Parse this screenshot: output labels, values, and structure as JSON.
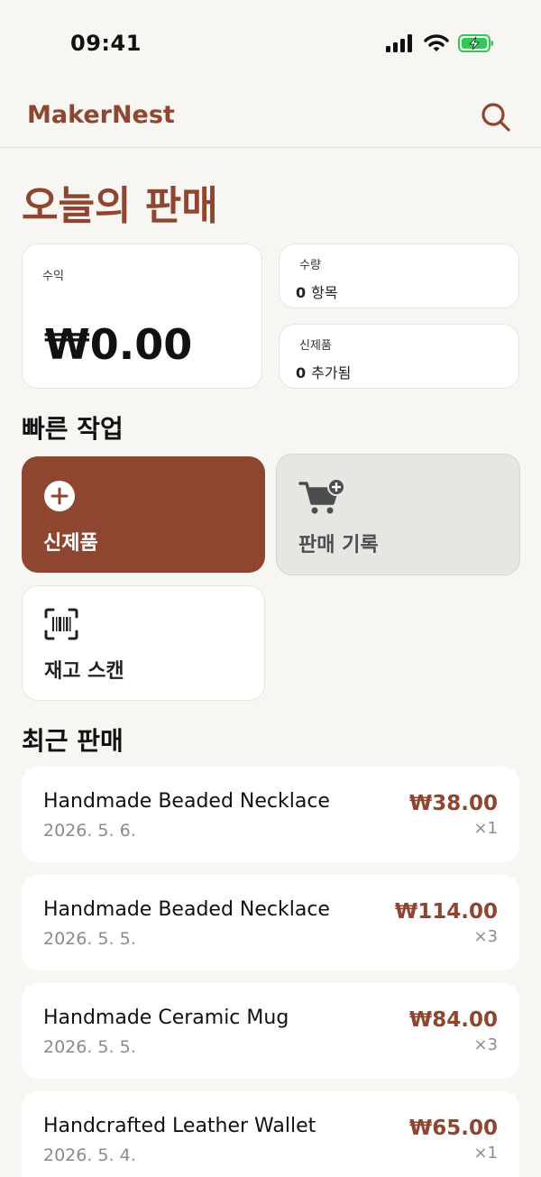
{
  "status": {
    "time": "09:41"
  },
  "header": {
    "brand": "MakerNest"
  },
  "page": {
    "title": "오늘의 판매"
  },
  "stats": {
    "revenue": {
      "label": "수익",
      "value": "₩0.00"
    },
    "quantity": {
      "label": "수량",
      "count": "0",
      "unit": "항목"
    },
    "new_products": {
      "label": "신제품",
      "count": "0",
      "unit": "추가됨"
    }
  },
  "quick_actions": {
    "title": "빠른 작업",
    "new_product": "신제품",
    "record_sale": "판매 기록",
    "scan_inventory": "재고 스캔"
  },
  "recent_sales": {
    "title": "최근 판매",
    "items": [
      {
        "name": "Handmade Beaded Necklace",
        "date": "2026. 5. 6.",
        "price": "₩38.00",
        "qty": "×1"
      },
      {
        "name": "Handmade Beaded Necklace",
        "date": "2026. 5. 5.",
        "price": "₩114.00",
        "qty": "×3"
      },
      {
        "name": "Handmade Ceramic Mug",
        "date": "2026. 5. 5.",
        "price": "₩84.00",
        "qty": "×3"
      },
      {
        "name": "Handcrafted Leather Wallet",
        "date": "2026. 5. 4.",
        "price": "₩65.00",
        "qty": "×1"
      }
    ]
  },
  "colors": {
    "accent": "#8f4630",
    "background": "#f8f6f2",
    "battery": "#34c759"
  },
  "icons": {
    "search": "search-icon",
    "add": "plus-circle-icon",
    "cart": "cart-plus-icon",
    "scan": "barcode-scan-icon"
  }
}
